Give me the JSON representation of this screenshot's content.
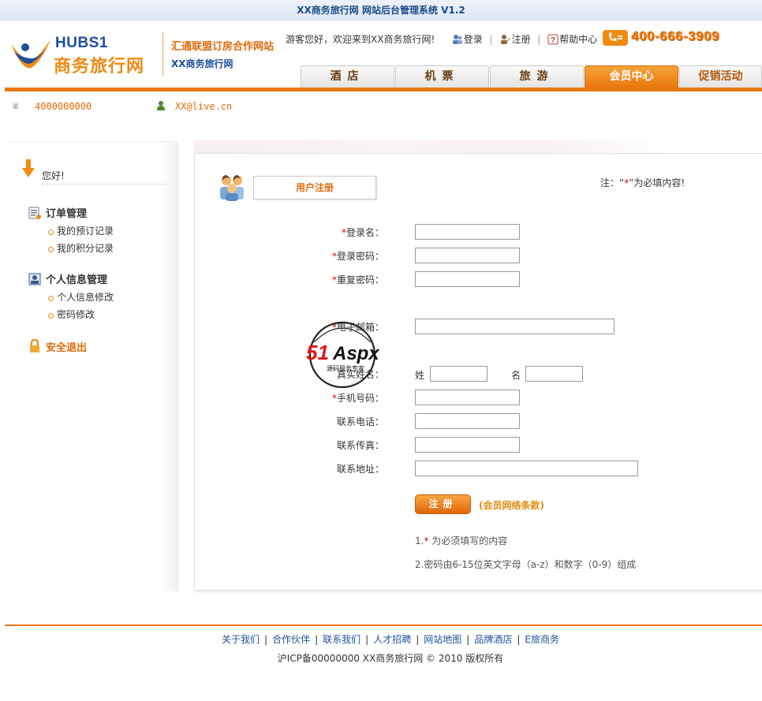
{
  "topbar": {
    "title": "XX商务旅行网 网站后台管理系统 V1.2"
  },
  "header": {
    "logo_en": "HUBS1",
    "logo_cn": "商务旅行网",
    "slogan_main": "汇通联盟订房合作网站",
    "slogan_sub": "XX商务旅行网",
    "welcome": "游客您好，欢迎来到XX商务旅行网!",
    "login_label": "登录",
    "register_label": "注册",
    "help_label": "帮助中心",
    "hotline": "400-666-3909"
  },
  "nav": {
    "tabs": [
      {
        "label": "酒店"
      },
      {
        "label": "机票"
      },
      {
        "label": "旅游"
      },
      {
        "label": "会员中心"
      },
      {
        "label": "促销活动"
      }
    ]
  },
  "contact": {
    "phone": "4000000000",
    "email": "XX@live.cn"
  },
  "sidebar": {
    "greeting": "您好!",
    "groups": [
      {
        "title": "订单管理",
        "items": [
          "我的预订记录",
          "我的积分记录"
        ]
      },
      {
        "title": "个人信息管理",
        "items": [
          "个人信息修改",
          "密码修改"
        ]
      }
    ],
    "logout": "安全退出"
  },
  "form": {
    "title": "用户注册",
    "note_prefix": "注：“",
    "note_star": "*",
    "note_suffix": "”为必填内容!",
    "fields": {
      "username": {
        "label": "登录名：",
        "required": true,
        "value": ""
      },
      "password": {
        "label": "登录密码：",
        "required": true,
        "value": ""
      },
      "password2": {
        "label": "重复密码：",
        "required": true,
        "value": ""
      },
      "email": {
        "label": "电子邮箱：",
        "required": true,
        "value": ""
      },
      "realname": {
        "label": "真实姓名：",
        "required": false,
        "surname_label": "姓",
        "given_label": "名",
        "surname_value": "",
        "given_value": ""
      },
      "mobile": {
        "label": "手机号码：",
        "required": true,
        "value": ""
      },
      "phone": {
        "label": "联系电话：",
        "required": false,
        "value": ""
      },
      "fax": {
        "label": "联系传真：",
        "required": false,
        "value": ""
      },
      "address": {
        "label": "联系地址：",
        "required": false,
        "value": ""
      }
    },
    "submit_label": "注册",
    "terms_label": "(会员网络条款)",
    "hint1_prefix": "1.",
    "hint1_star": "*",
    "hint1_text": " 为必须填写的内容",
    "hint2": "2.密码由6-15位英文字母（a-z）和数字（0-9）组成"
  },
  "watermark": {
    "brand": "51Aspx",
    "tagline": "源码服务专家"
  },
  "footer": {
    "links": [
      "关于我们",
      "合作伙伴",
      "联系我们",
      "人才招聘",
      "网站地图",
      "品牌酒店",
      "E旅商务"
    ],
    "copyright": "沪ICP备00000000 XX商务旅行网 © 2010 版权所有"
  },
  "colors": {
    "accent_orange": "#e77812",
    "brand_blue": "#1d4f9c",
    "required_red": "#dd0000"
  }
}
